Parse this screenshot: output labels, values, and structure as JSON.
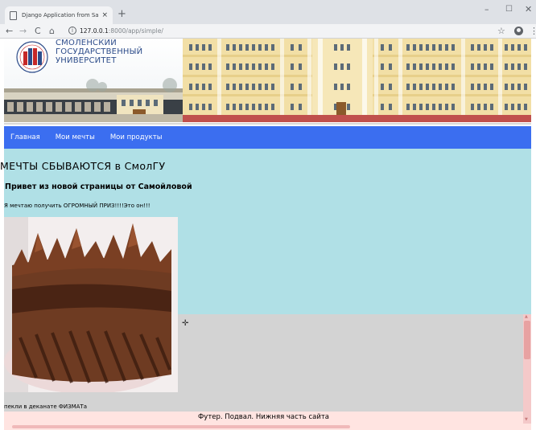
{
  "browser": {
    "tab_title": "Django Application from Samoil...",
    "tab_close": "×",
    "new_tab": "+",
    "url_host": "127.0.0.1",
    "url_path": ":8000/app/simple/",
    "window_min": "–",
    "window_max": "☐",
    "window_close": "✕",
    "back": "←",
    "forward": "→",
    "reload": "C",
    "home": "⌂",
    "info": "i",
    "star": "☆",
    "menu": "⋮"
  },
  "header": {
    "uni_name_line1": "СМОЛЕНСКИЙ",
    "uni_name_line2": "ГОСУДАРСТВЕННЫЙ",
    "uni_name_line3": "УНИВЕРСИТЕТ",
    "colors": {
      "brand_blue": "#2d4c8a",
      "brand_red": "#c62828"
    }
  },
  "nav": {
    "items": [
      {
        "label": "Главная"
      },
      {
        "label": "Мои мечты"
      },
      {
        "label": "Мои продукты"
      }
    ],
    "color": "#3b6ef0"
  },
  "main": {
    "title": "МЕЧТЫ СБЫВАЮТСЯ в СмолГУ",
    "greeting": "Привет из новой страницы от Самойловой",
    "dream_text": "Я мечтаю получить ОГРОМНЫЙ ПРИЗ!!!!Это он!!!",
    "caption": "пекли в деканате ФИЗМАТа",
    "image_icon": "chocolate-cake-image",
    "colors": {
      "content_bg": "#b0e0e6",
      "lower_bg": "#d3d3d3"
    }
  },
  "footer": {
    "text": "Футер. Подвал. Нижняя часть сайта",
    "color": "#ffe4e1"
  }
}
